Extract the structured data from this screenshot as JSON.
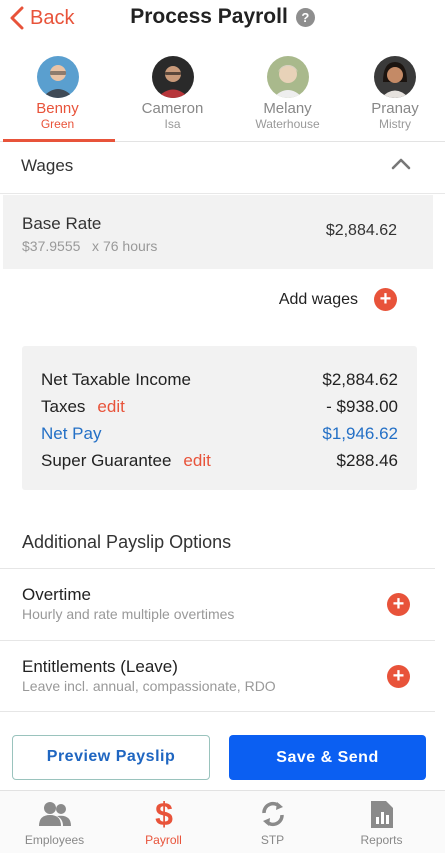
{
  "header": {
    "back_label": "Back",
    "title": "Process Payroll",
    "help_glyph": "?"
  },
  "employees": [
    {
      "first": "Benny",
      "last": "Green",
      "active": true
    },
    {
      "first": "Cameron",
      "last": "Isa",
      "active": false
    },
    {
      "first": "Melany",
      "last": "Waterhouse",
      "active": false
    },
    {
      "first": "Pranay",
      "last": "Mistry",
      "active": false
    }
  ],
  "wages": {
    "section_label": "Wages",
    "base_rate_label": "Base Rate",
    "base_rate_detail": "$37.9555   x 76 hours",
    "base_rate_amount": "$2,884.62",
    "add_wages_label": "Add wages"
  },
  "summary": {
    "taxable_label": "Net Taxable Income",
    "taxable_value": "$2,884.62",
    "taxes_label": "Taxes",
    "taxes_edit": "edit",
    "taxes_value": "- $938.00",
    "netpay_label": "Net Pay",
    "netpay_value": "$1,946.62",
    "super_label": "Super Guarantee",
    "super_edit": "edit",
    "super_value": "$288.46"
  },
  "options": {
    "heading": "Additional Payslip Options",
    "overtime_title": "Overtime",
    "overtime_sub": "Hourly and rate multiple overtimes",
    "leave_title": "Entitlements (Leave)",
    "leave_sub": "Leave incl. annual, compassionate, RDO"
  },
  "actions": {
    "preview_label": "Preview Payslip",
    "save_label": "Save & Send"
  },
  "tabs": {
    "employees": "Employees",
    "payroll": "Payroll",
    "stp": "STP",
    "reports": "Reports"
  },
  "colors": {
    "accent": "#e8533a",
    "primary": "#0b5ff2",
    "link": "#2470c6"
  }
}
